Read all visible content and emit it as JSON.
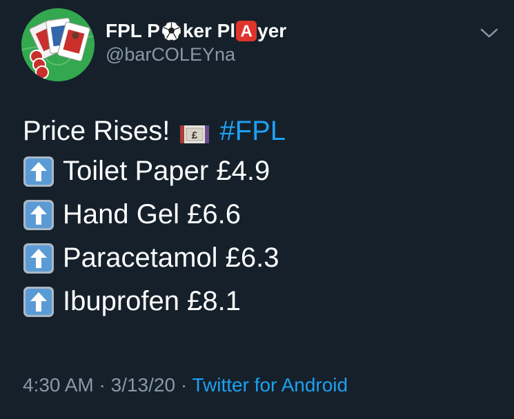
{
  "author": {
    "name_part1": "FPL P",
    "name_part2": "ker Pl",
    "name_part3": "yer",
    "name_icon_1": "soccer-ball-icon",
    "name_icon_2": "letter-a-icon",
    "name_icon_2_text": "A",
    "handle": "@barCOLEYna",
    "avatar_icon": "playing-cards-avatar-icon"
  },
  "header": {
    "menu_icon": "chevron-down-icon"
  },
  "tweet": {
    "intro_text": "Price Rises!",
    "intro_icon": "money-note-icon",
    "hashtag": "#FPL",
    "items": [
      {
        "icon": "up-arrow-icon",
        "text": "Toilet Paper £4.9"
      },
      {
        "icon": "up-arrow-icon",
        "text": "Hand Gel £6.6"
      },
      {
        "icon": "up-arrow-icon",
        "text": "Paracetamol £6.3"
      },
      {
        "icon": "up-arrow-icon",
        "text": "Ibuprofen £8.1"
      }
    ]
  },
  "meta": {
    "time": "4:30 AM",
    "separator": "·",
    "date": "3/13/20",
    "source": "Twitter for Android"
  },
  "colors": {
    "background": "#15202b",
    "text": "#ffffff",
    "secondary": "#8899a6",
    "accent": "#1da1f2",
    "arrow_box": "#5b9bd5"
  }
}
